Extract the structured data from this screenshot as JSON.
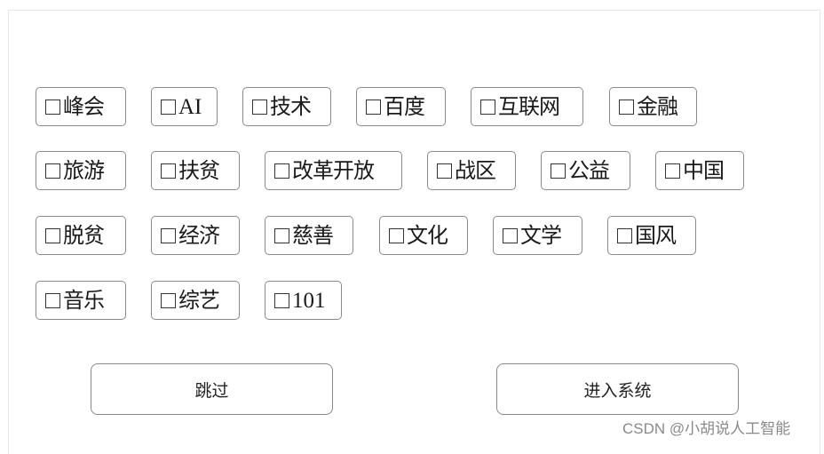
{
  "tags": {
    "row1": [
      {
        "label": "峰会",
        "checked": false
      },
      {
        "label": "AI",
        "checked": false
      },
      {
        "label": "技术",
        "checked": false
      },
      {
        "label": "百度",
        "checked": false
      },
      {
        "label": "互联网",
        "checked": false
      },
      {
        "label": "金融",
        "checked": false
      }
    ],
    "row2": [
      {
        "label": "旅游",
        "checked": false
      },
      {
        "label": "扶贫",
        "checked": false
      },
      {
        "label": "改革开放",
        "checked": false
      },
      {
        "label": "战区",
        "checked": false
      },
      {
        "label": "公益",
        "checked": false
      },
      {
        "label": "中国",
        "checked": false
      }
    ],
    "row3": [
      {
        "label": "脱贫",
        "checked": false
      },
      {
        "label": "经济",
        "checked": false
      },
      {
        "label": "慈善",
        "checked": false
      },
      {
        "label": "文化",
        "checked": false
      },
      {
        "label": "文学",
        "checked": false
      },
      {
        "label": "国风",
        "checked": false
      }
    ],
    "row4": [
      {
        "label": "音乐",
        "checked": false
      },
      {
        "label": "综艺",
        "checked": false
      },
      {
        "label": "101",
        "checked": false
      }
    ]
  },
  "buttons": {
    "skip_label": "跳过",
    "enter_label": "进入系统"
  },
  "watermark": "CSDN @小胡说人工智能",
  "icons": {
    "checkbox": "checkbox-unchecked-icon"
  }
}
